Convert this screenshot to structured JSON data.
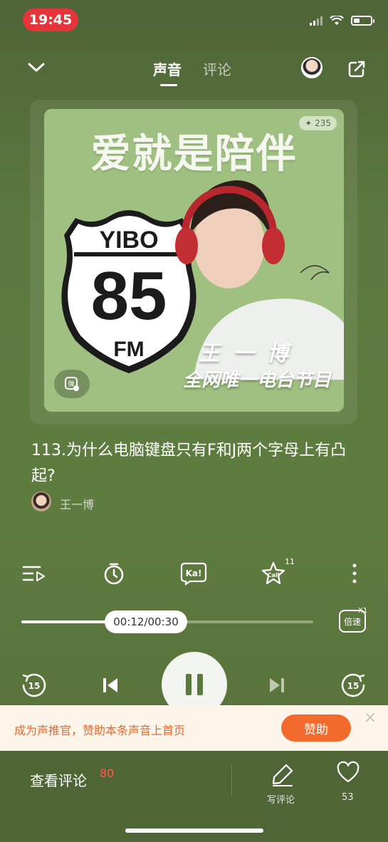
{
  "status_bar": {
    "time": "19:45"
  },
  "nav": {
    "tab_sound": "声音",
    "tab_comments": "评论"
  },
  "cover": {
    "title": "爱就是陪伴",
    "badge_count": "✦ 235",
    "logo_top": "YIBO",
    "logo_num": "85",
    "logo_bottom": "FM",
    "host_line": "王一博",
    "tagline": "全网唯一电台节目",
    "danmu_icon": "danmu-icon"
  },
  "episode": {
    "title": "113.为什么电脑键盘只有F和J两个字母上有凸起?",
    "author": "王一博"
  },
  "functions": {
    "call_count": "11",
    "call_label": "Call",
    "ka_label": "Ka!"
  },
  "player": {
    "time": "00:12/00:30",
    "progress": 0.4,
    "speed_label": "倍速",
    "speed_value": "X1",
    "rewind_label": "15",
    "forward_label": "15"
  },
  "banner": {
    "text": "成为声推官，赞助本条声音上首页",
    "button": "赞助"
  },
  "bottom": {
    "comments_label": "查看评论",
    "comments_count": "80",
    "write_label": "写评论",
    "like_count": "53"
  },
  "colors": {
    "accent": "#f26b2c",
    "time_pill": "#e5343a",
    "background": "#5c7a3f"
  }
}
